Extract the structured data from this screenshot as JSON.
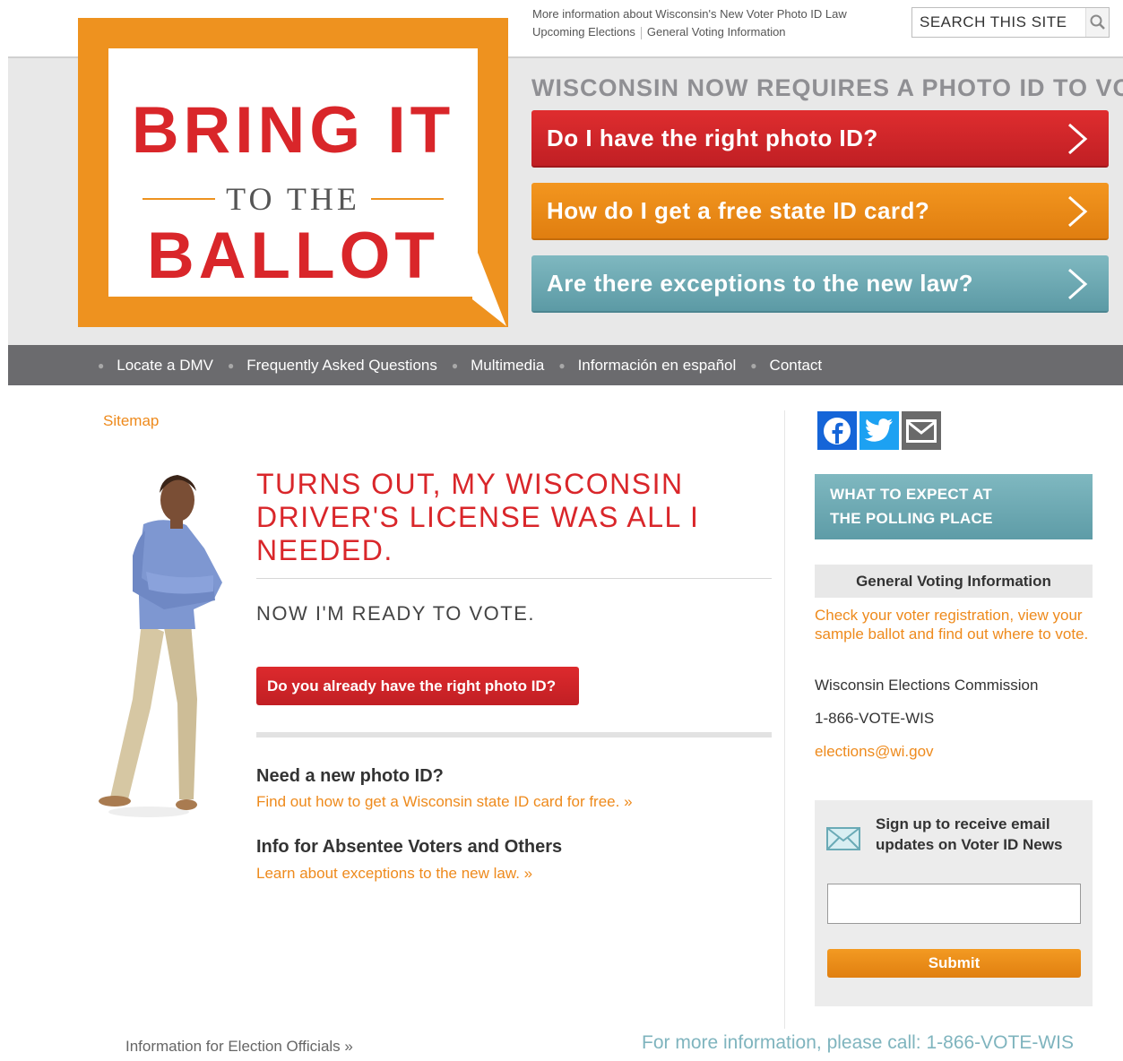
{
  "logo": {
    "line1": "BRING IT",
    "line2": "TO THE",
    "line3": "BALLOT",
    "colors": {
      "orange": "#ee921f",
      "red": "#d9262a"
    }
  },
  "toplinks": {
    "photo_id_law": "More information about Wisconsin's New Voter Photo ID Law",
    "upcoming": "Upcoming Elections",
    "general": "General Voting Information"
  },
  "search": {
    "placeholder": "SEARCH THIS SITE",
    "icon": "magnifier-icon"
  },
  "headline": "WISCONSIN NOW REQUIRES A PHOTO ID TO VOTE",
  "cta": [
    {
      "label": "Do I have the right photo ID?",
      "color": "#d12729"
    },
    {
      "label": "How do I get a free state ID card?",
      "color": "#ec8a18"
    },
    {
      "label": "Are there exceptions to the new law?",
      "color": "#6ea9b3"
    }
  ],
  "nav": [
    "Locate a DMV",
    "Frequently Asked Questions",
    "Multimedia",
    "Información en español",
    "Contact"
  ],
  "sitemap": "Sitemap",
  "main": {
    "title": "TURNS OUT, MY WISCONSIN DRIVER'S LICENSE WAS ALL I NEEDED.",
    "ready": "NOW I'M READY TO VOTE.",
    "button": "Do you already have the right photo ID?",
    "section1_heading": "Need a new photo ID?",
    "section1_link": "Find out how to get a Wisconsin state ID card for free. »",
    "section2_heading": "Info for Absentee Voters and Others",
    "section2_link": "Learn about exceptions to the new law. »"
  },
  "sidebar": {
    "social": [
      "facebook-icon",
      "twitter-icon",
      "email-icon"
    ],
    "expect_line1": "WHAT TO EXPECT AT",
    "expect_line2": "THE POLLING PLACE",
    "gvi_heading": "General Voting Information",
    "gvi_link": "Check your voter registration, view your sample ballot and find out where to vote.",
    "commission": "Wisconsin Elections Commission",
    "phone": "1-866-VOTE-WIS",
    "email": "elections@wi.gov",
    "signup_text": "Sign up to receive email updates on Voter ID News",
    "signup_input": "",
    "submit": "Submit"
  },
  "footer": {
    "officials": "Information for Election Officials »",
    "call": "For more information, please call: 1-866-VOTE-WIS"
  }
}
